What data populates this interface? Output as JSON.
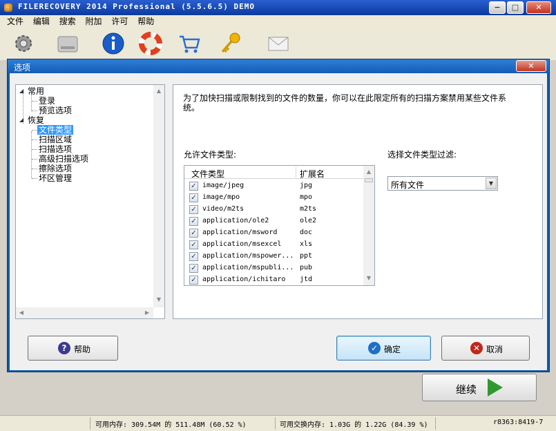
{
  "app": {
    "title": "FILERECOVERY 2014 Professional (5.5.6.5) DEMO",
    "window_buttons": {
      "minimize": "−",
      "maximize": "□",
      "close": "✕"
    }
  },
  "menu": [
    "文件",
    "编辑",
    "搜索",
    "附加",
    "许可",
    "帮助"
  ],
  "toolbar": [
    "gear-icon",
    "drive-icon",
    "info-icon",
    "lifebuoy-icon",
    "cart-icon",
    "key-icon",
    "mail-icon"
  ],
  "dialog": {
    "title": "选项",
    "close": "✕",
    "tree": [
      {
        "label": "常用",
        "level": 0,
        "expanded": true
      },
      {
        "label": "登录",
        "level": 1
      },
      {
        "label": "预览选项",
        "level": 1
      },
      {
        "label": "恢复",
        "level": 0,
        "expanded": true
      },
      {
        "label": "文件类型",
        "level": 1,
        "selected": true
      },
      {
        "label": "扫描区域",
        "level": 1
      },
      {
        "label": "扫描选项",
        "level": 1
      },
      {
        "label": "高级扫描选项",
        "level": 1
      },
      {
        "label": "擦除选项",
        "level": 1
      },
      {
        "label": "坏区管理",
        "level": 1
      }
    ],
    "description": "为了加快扫描或限制找到的文件的数量，你可以在此限定所有的扫描方案禁用某些文件系统。",
    "allowed_label": "允许文件类型:",
    "filter_label": "选择文件类型过滤:",
    "columns": [
      "文件类型",
      "扩展名"
    ],
    "file_types": [
      {
        "type": "image/jpeg",
        "ext": "jpg",
        "checked": true
      },
      {
        "type": "image/mpo",
        "ext": "mpo",
        "checked": true
      },
      {
        "type": "video/m2ts",
        "ext": "m2ts",
        "checked": true
      },
      {
        "type": "application/ole2",
        "ext": "ole2",
        "checked": true
      },
      {
        "type": "application/msword",
        "ext": "doc",
        "checked": true
      },
      {
        "type": "application/msexcel",
        "ext": "xls",
        "checked": true
      },
      {
        "type": "application/mspower...",
        "ext": "ppt",
        "checked": true
      },
      {
        "type": "application/mspubli...",
        "ext": "pub",
        "checked": true
      },
      {
        "type": "application/ichitaro",
        "ext": "jtd",
        "checked": true
      }
    ],
    "filter_value": "所有文件",
    "buttons": {
      "help": "帮助",
      "ok": "确定",
      "cancel": "取消"
    }
  },
  "continue_label": "继续",
  "status": {
    "mem": "可用内存: 309.54M 的 511.48M (60.52 %)",
    "swap": "可用交换内存: 1.03G 的 1.22G (84.39 %)",
    "id": "r8363:8419-7"
  }
}
